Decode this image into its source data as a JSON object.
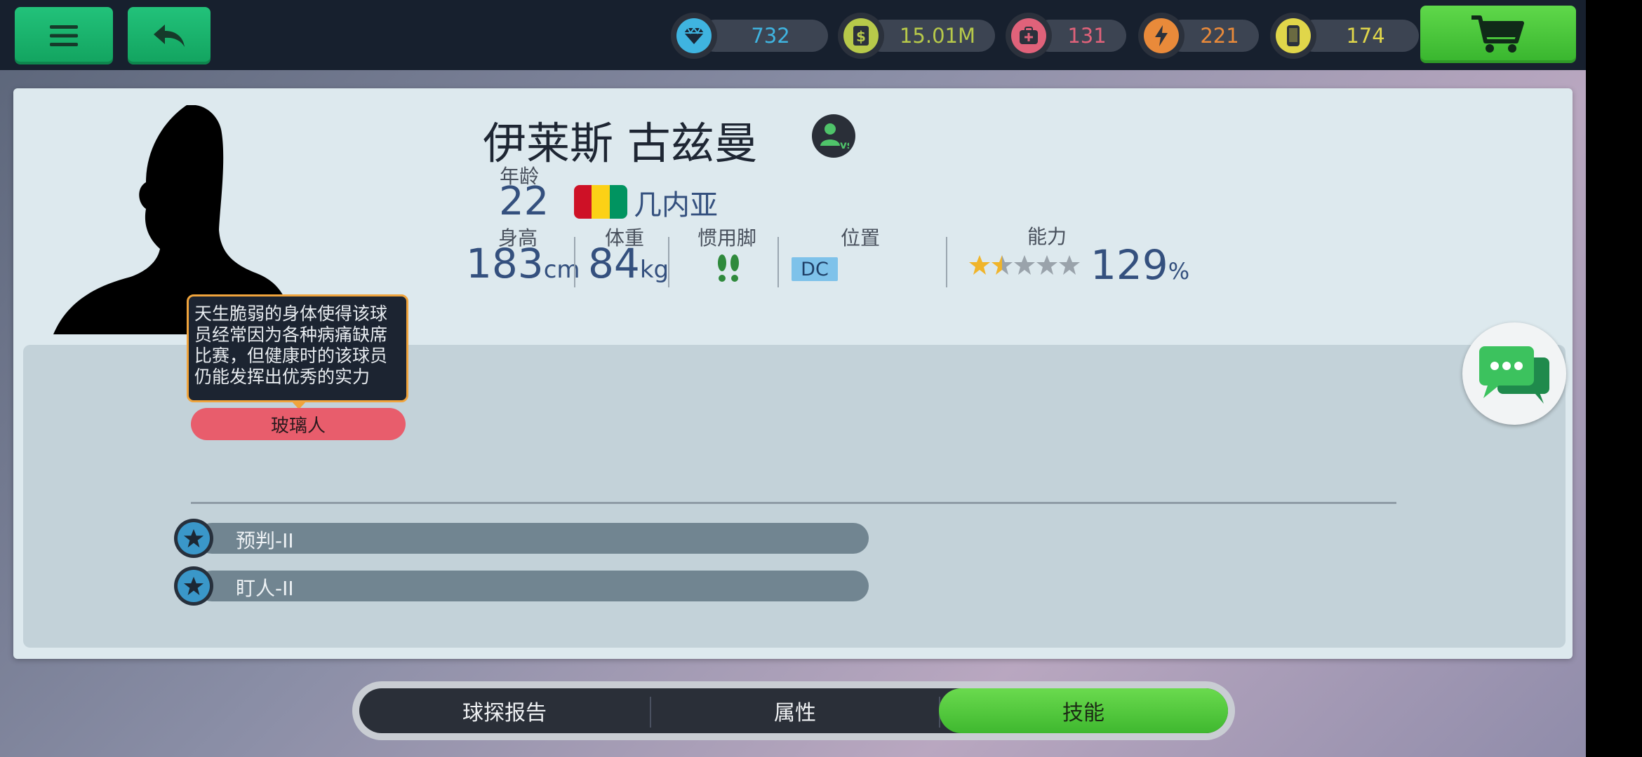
{
  "topbar": {
    "menu_icon": "hamburger-icon",
    "back_icon": "back-arrow-icon",
    "currencies": [
      {
        "name": "diamond",
        "icon": "diamond-icon",
        "value": "732",
        "color": "#3fb4e0"
      },
      {
        "name": "cash",
        "icon": "dollar-icon",
        "value": "15.01M",
        "color": "#b7c94a"
      },
      {
        "name": "medical",
        "icon": "medkit-icon",
        "value": "131",
        "color": "#e0627a"
      },
      {
        "name": "energy",
        "icon": "lightning-icon",
        "value": "221",
        "color": "#e98a3a"
      },
      {
        "name": "cards",
        "icon": "phone-icon",
        "value": "174",
        "color": "#e0d64a"
      }
    ],
    "cart_icon": "shopping-cart-icon"
  },
  "player": {
    "name": "伊莱斯 古兹曼",
    "age_label": "年龄",
    "age": "22",
    "country": "几内亚",
    "height_label": "身高",
    "height": "183",
    "height_unit": "cm",
    "weight_label": "体重",
    "weight": "84",
    "weight_unit": "kg",
    "foot_label": "惯用脚",
    "position_label": "位置",
    "position": "DC",
    "ability_label": "能力",
    "stars": 1.5,
    "ability": "129",
    "ability_unit": "%"
  },
  "trait": {
    "tooltip": "天生脆弱的身体使得该球员经常因为各种病痛缺席比赛，但健康时的该球员仍能发挥出优秀的实力",
    "label": "玻璃人"
  },
  "skills": [
    {
      "label": "预判-II"
    },
    {
      "label": "盯人-II"
    }
  ],
  "tabs": [
    {
      "label": "球探报告",
      "active": false
    },
    {
      "label": "属性",
      "active": false
    },
    {
      "label": "技能",
      "active": true
    }
  ]
}
